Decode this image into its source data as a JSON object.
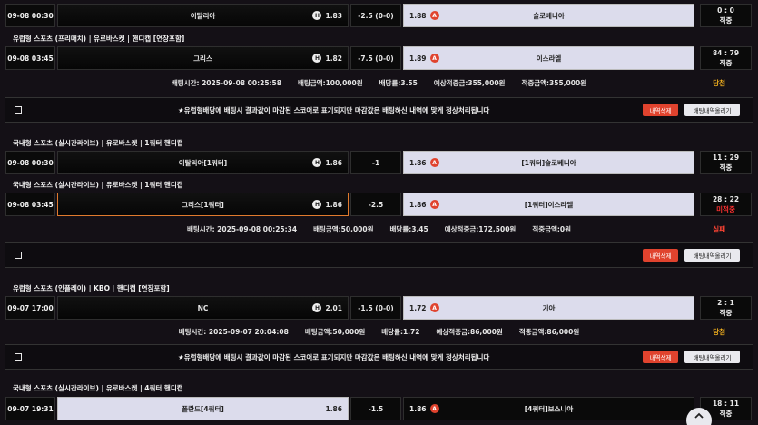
{
  "notice": "★유럽형배당에 배팅시 결과값이 마감된 스코어로 표기되지만 마감값은 배팅하신 내역에 맞게 정상처리됩니다",
  "buttons": {
    "delete": "내역삭제",
    "upload": "배팅내역올리기"
  },
  "bets": [
    {
      "matches": [
        {
          "league": "",
          "time": "09-08 00:30",
          "home": "이탈리아",
          "home_odds": "1.83",
          "hc": "-2.5 (0-0)",
          "away_odds": "1.88",
          "away": "슬로베니아",
          "score": "0 : 0",
          "result": "적중"
        },
        {
          "league": "유럽형 스포츠 (프리매치) | 유로바스켓 | 핸디캡 [연장포함]",
          "time": "09-08 03:45",
          "home": "그리스",
          "home_odds": "1.82",
          "hc": "-7.5 (0-0)",
          "away_odds": "1.89",
          "away": "이스라엘",
          "score": "84 : 79",
          "result": "적중"
        }
      ],
      "info": {
        "bet_time": "배팅시간: 2025-09-08 00:25:58",
        "amount": "배팅금액:100,000원",
        "rate": "배당률:3.55",
        "expected": "예상적중금:355,000원",
        "win": "적중금액:355,000원",
        "status": "당첨"
      }
    },
    {
      "matches": [
        {
          "league": "국내형 스포츠 (실시간라이브) | 유로바스켓 | 1쿼터 핸디캡",
          "time": "09-08 00:30",
          "home": "이탈리아[1쿼터]",
          "home_odds": "1.86",
          "hc": "-1",
          "away_odds": "1.86",
          "away": "[1쿼터]슬로베니아",
          "score": "11 : 29",
          "result": "적중"
        },
        {
          "league": "국내형 스포츠 (실시간라이브) | 유로바스켓 | 1쿼터 핸디캡",
          "time": "09-08 03:45",
          "home": "그리스[1쿼터]",
          "home_odds": "1.86",
          "hc": "-2.5",
          "away_odds": "1.86",
          "away": "[1쿼터]이스라엘",
          "score": "28 : 22",
          "result": "미적중"
        }
      ],
      "info": {
        "bet_time": "배팅시간: 2025-09-08 00:25:34",
        "amount": "배팅금액:50,000원",
        "rate": "배당률:3.45",
        "expected": "예상적중금:172,500원",
        "win": "적중금액:0원",
        "status": "실패"
      }
    },
    {
      "matches": [
        {
          "league": "유럽형 스포츠 (인플레이) | KBO | 핸디캡 [연장포함]",
          "time": "09-07 17:00",
          "home": "NC",
          "home_odds": "2.01",
          "hc": "-1.5 (0-0)",
          "away_odds": "1.72",
          "away": "기아",
          "score": "2 : 1",
          "result": "적중"
        }
      ],
      "info": {
        "bet_time": "배팅시간: 2025-09-07 20:04:08",
        "amount": "배팅금액:50,000원",
        "rate": "배당률:1.72",
        "expected": "예상적중금:86,000원",
        "win": "적중금액:86,000원",
        "status": "당첨"
      }
    },
    {
      "matches": [
        {
          "league": "국내형 스포츠 (실시간라이브) | 유로바스켓 | 4쿼터 핸디캡",
          "time": "09-07 19:31",
          "home": "폴란드[4쿼터]",
          "home_odds": "1.86",
          "hc": "-1.5",
          "away_odds": "1.86",
          "away": "[4쿼터]보스니아",
          "score": "18 : 11",
          "result": "적중"
        }
      ]
    }
  ]
}
